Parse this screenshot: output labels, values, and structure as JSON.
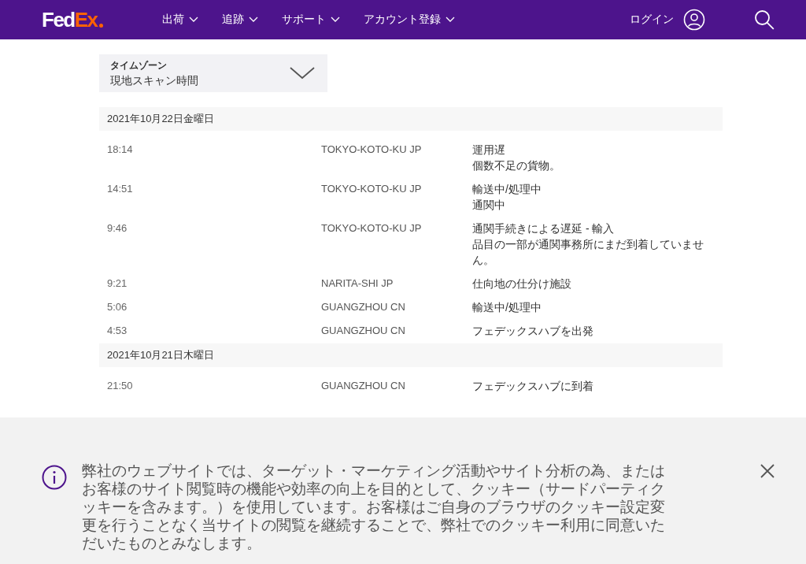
{
  "header": {
    "logo_parts": [
      "Fed",
      "Ex"
    ],
    "nav": [
      {
        "label": "出荷"
      },
      {
        "label": "追跡"
      },
      {
        "label": "サポート"
      },
      {
        "label": "アカウント登録"
      }
    ],
    "login": "ログイン"
  },
  "timezone": {
    "label": "タイムゾーン",
    "value": "現地スキャン時間"
  },
  "days": [
    {
      "date": "2021年10月22日金曜日",
      "events": [
        {
          "time": "18:14",
          "location": "TOKYO-KOTO-KU JP",
          "lines": [
            "運用遅",
            "個数不足の貨物。"
          ]
        },
        {
          "time": "14:51",
          "location": "TOKYO-KOTO-KU JP",
          "lines": [
            "輸送中/処理中",
            "通関中"
          ]
        },
        {
          "time": "9:46",
          "location": "TOKYO-KOTO-KU JP",
          "lines": [
            "通関手続きによる遅延 - 輸入",
            "品目の一部が通関事務所にまだ到着していません。"
          ]
        },
        {
          "time": "9:21",
          "location": "NARITA-SHI JP",
          "lines": [
            "仕向地の仕分け施設"
          ]
        },
        {
          "time": "5:06",
          "location": "GUANGZHOU CN",
          "lines": [
            "輸送中/処理中"
          ]
        },
        {
          "time": "4:53",
          "location": "GUANGZHOU CN",
          "lines": [
            "フェデックスハブを出発"
          ]
        }
      ]
    },
    {
      "date": "2021年10月21日木曜日",
      "events": [
        {
          "time": "21:50",
          "location": "GUANGZHOU CN",
          "lines": [
            "フェデックスハブに到着"
          ]
        }
      ]
    }
  ],
  "cookie_banner": {
    "text": "弊社のウェブサイトでは、ターゲット・マーケティング活動やサイト分析の為、またはお客様のサイト閲覧時の機能や効率の向上を目的として、クッキー（サードパーティクッキーを含みます。）を使用しています。お客様はご自身のブラウザのクッキー設定変更を行うことなく当サイトの閲覧を継続することで、弊社でのクッキー利用に同意いただいたものとみなします。"
  }
}
